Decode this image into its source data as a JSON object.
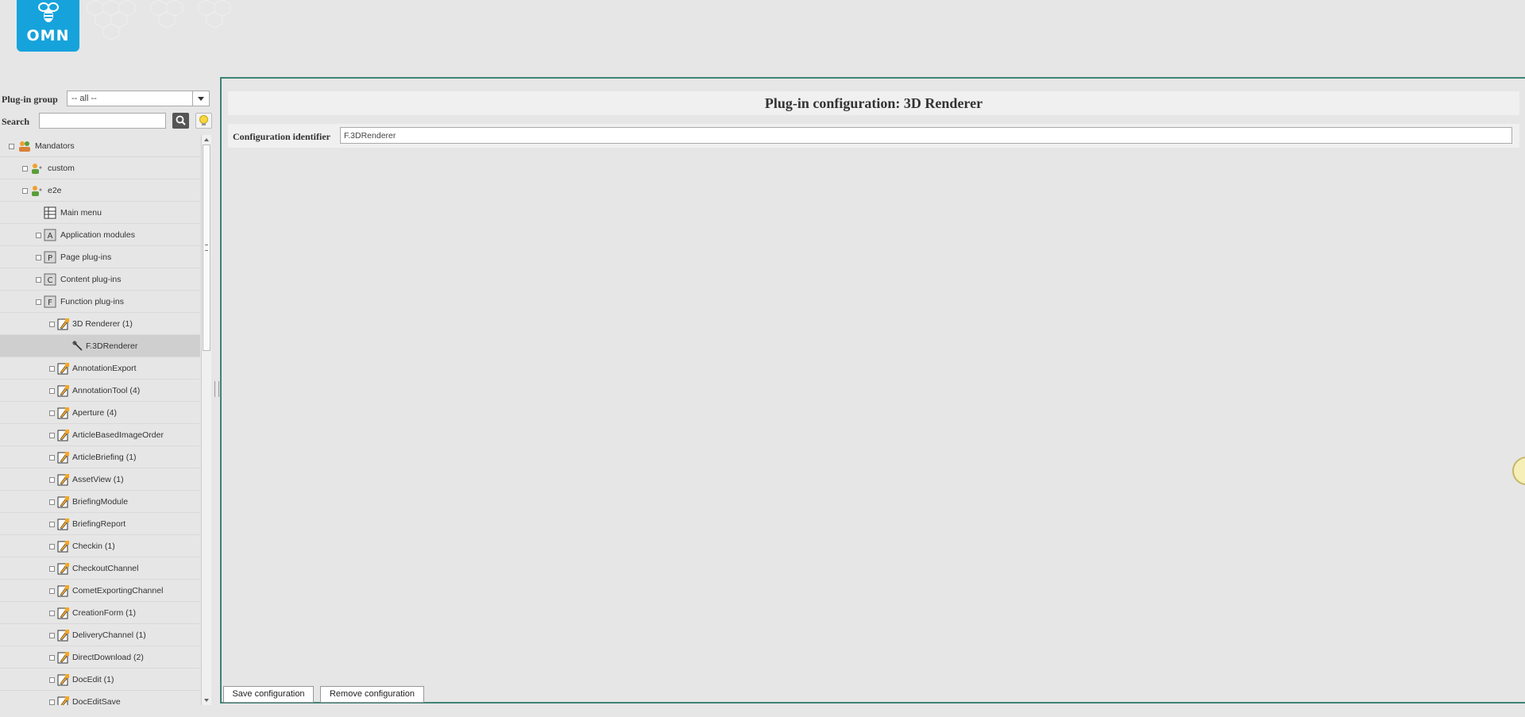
{
  "header": {
    "logo_text": "OMN"
  },
  "sidebar": {
    "plugin_group_label": "Plug-in group",
    "plugin_group_value": "-- all --",
    "search_label": "Search",
    "search_value": "",
    "tree": [
      {
        "label": "Mandators",
        "level": 0,
        "icon": "mandators-icon",
        "toggle": true
      },
      {
        "label": "custom",
        "level": 1,
        "icon": "mandator-icon",
        "toggle": true
      },
      {
        "label": "e2e",
        "level": 1,
        "icon": "mandator-icon",
        "toggle": true
      },
      {
        "label": "Main menu",
        "level": 2,
        "icon": "menu-grid-icon",
        "toggle": false
      },
      {
        "label": "Application modules",
        "level": 2,
        "icon": "letter-a-icon",
        "toggle": true
      },
      {
        "label": "Page plug-ins",
        "level": 2,
        "icon": "letter-p-icon",
        "toggle": true
      },
      {
        "label": "Content plug-ins",
        "level": 2,
        "icon": "letter-c-icon",
        "toggle": true
      },
      {
        "label": "Function plug-ins",
        "level": 2,
        "icon": "letter-f-icon",
        "toggle": true
      },
      {
        "label": "3D Renderer (1)",
        "level": 3,
        "icon": "plugin-icon",
        "toggle": true
      },
      {
        "label": "F.3DRenderer",
        "level": 4,
        "icon": "wrench-icon",
        "toggle": false,
        "selected": true
      },
      {
        "label": "AnnotationExport",
        "level": 3,
        "icon": "plugin-icon",
        "toggle": true
      },
      {
        "label": "AnnotationTool (4)",
        "level": 3,
        "icon": "plugin-icon",
        "toggle": true
      },
      {
        "label": "Aperture (4)",
        "level": 3,
        "icon": "plugin-icon",
        "toggle": true
      },
      {
        "label": "ArticleBasedImageOrder",
        "level": 3,
        "icon": "plugin-icon",
        "toggle": true
      },
      {
        "label": "ArticleBriefing (1)",
        "level": 3,
        "icon": "plugin-icon",
        "toggle": true
      },
      {
        "label": "AssetView (1)",
        "level": 3,
        "icon": "plugin-icon",
        "toggle": true
      },
      {
        "label": "BriefingModule",
        "level": 3,
        "icon": "plugin-icon",
        "toggle": true
      },
      {
        "label": "BriefingReport",
        "level": 3,
        "icon": "plugin-icon",
        "toggle": true
      },
      {
        "label": "Checkin (1)",
        "level": 3,
        "icon": "plugin-icon",
        "toggle": true
      },
      {
        "label": "CheckoutChannel",
        "level": 3,
        "icon": "plugin-icon",
        "toggle": true
      },
      {
        "label": "CometExportingChannel",
        "level": 3,
        "icon": "plugin-icon",
        "toggle": true
      },
      {
        "label": "CreationForm (1)",
        "level": 3,
        "icon": "plugin-icon",
        "toggle": true
      },
      {
        "label": "DeliveryChannel (1)",
        "level": 3,
        "icon": "plugin-icon",
        "toggle": true
      },
      {
        "label": "DirectDownload (2)",
        "level": 3,
        "icon": "plugin-icon",
        "toggle": true
      },
      {
        "label": "DocEdit (1)",
        "level": 3,
        "icon": "plugin-icon",
        "toggle": true
      },
      {
        "label": "DocEditSave",
        "level": 3,
        "icon": "plugin-icon",
        "toggle": true
      }
    ]
  },
  "main": {
    "title": "Plug-in configuration: 3D Renderer",
    "config_identifier_label": "Configuration identifier",
    "config_identifier_value": "F.3DRenderer",
    "save_button": "Save configuration",
    "remove_button": "Remove configuration"
  },
  "colors": {
    "logo_blue": "#16a3dc",
    "panel_border": "#3f8376",
    "selected_row": "#cfcfcf",
    "plugin_icon_orange": "#f5a623"
  }
}
